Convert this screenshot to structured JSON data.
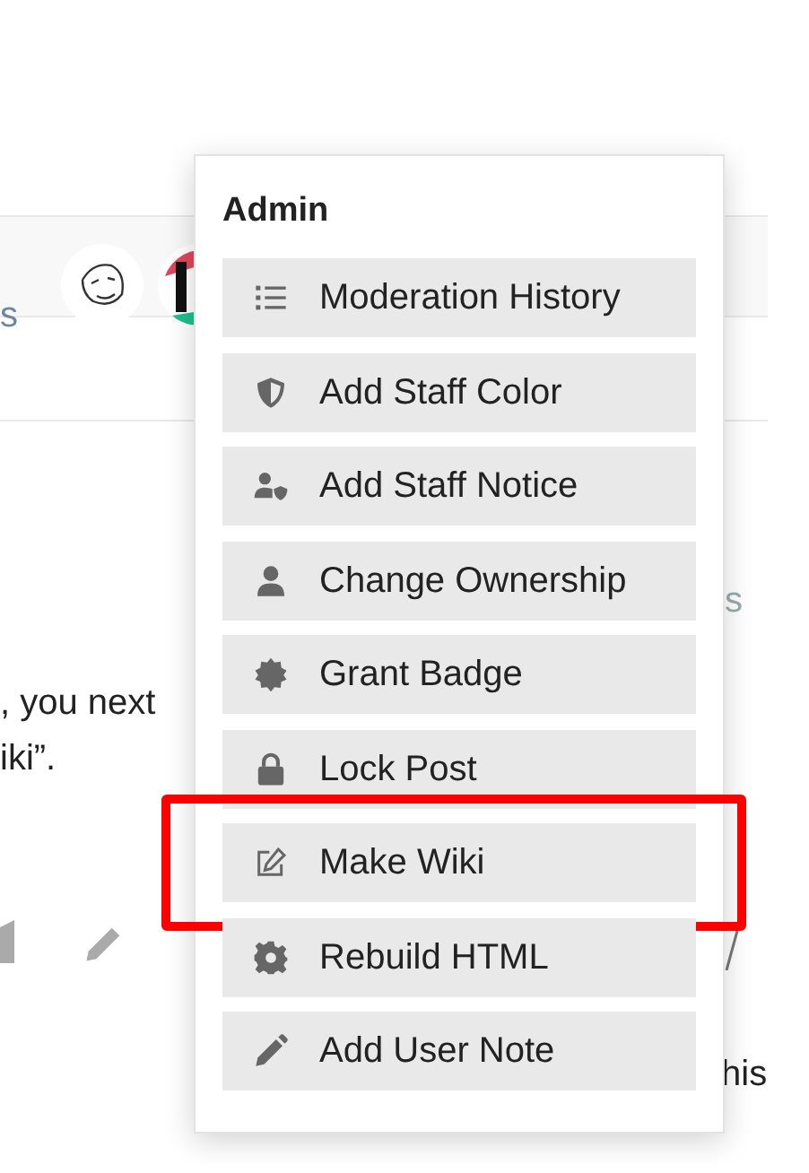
{
  "page": {
    "left_fragment": "s",
    "post_lines": [
      ", you next",
      "iki”."
    ],
    "right_fragments": [
      "s",
      "his"
    ]
  },
  "admin_menu": {
    "title": "Admin",
    "items": [
      {
        "label": "Moderation History",
        "highlighted": false
      },
      {
        "label": "Add Staff Color",
        "highlighted": false
      },
      {
        "label": "Add Staff Notice",
        "highlighted": false
      },
      {
        "label": "Change Ownership",
        "highlighted": false
      },
      {
        "label": "Grant Badge",
        "highlighted": false
      },
      {
        "label": "Lock Post",
        "highlighted": false
      },
      {
        "label": "Make Wiki",
        "highlighted": true
      },
      {
        "label": "Rebuild HTML",
        "highlighted": false
      },
      {
        "label": "Add User Note",
        "highlighted": false
      }
    ]
  }
}
